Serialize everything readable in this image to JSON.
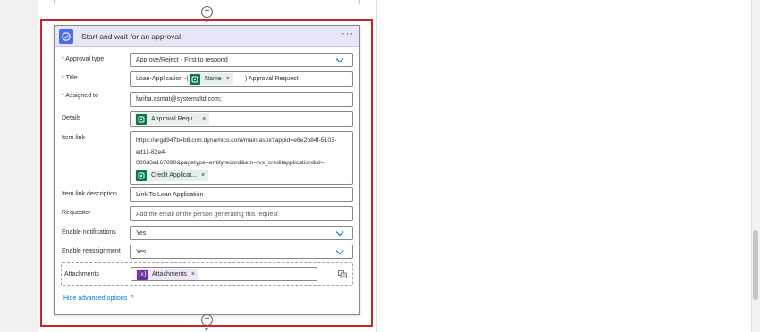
{
  "action": {
    "title": "Start and wait for an approval",
    "more_label": "···"
  },
  "fields": {
    "approval_type": {
      "label": "Approval type",
      "value": "Approve/Reject - First to respond"
    },
    "title": {
      "label": "Title",
      "prefix": "Loan-Application -(",
      "token": "Name",
      "suffix": ") Approval Request"
    },
    "assigned_to": {
      "label": "Assigned to",
      "value": "fariha.asmat@systemsltd.com;"
    },
    "details": {
      "label": "Details",
      "token": "Approval Requ..."
    },
    "item_link": {
      "label": "Item link",
      "line1": "https://orgd947b4b8.crm.dynamics.com/main.aspx?appid=e6e2b84f-5103-",
      "line2": "ed11-82e4-",
      "line3": "000d3a167890&pagetype=entityrecord&etn=tvs_creditapplication&id=",
      "token": "Credit Applicat..."
    },
    "item_link_description": {
      "label": "Item link description",
      "value": "Link To Loan Application"
    },
    "requestor": {
      "label": "Requestor",
      "placeholder": "Add the email of the person generating this request"
    },
    "enable_notifications": {
      "label": "Enable notifications",
      "value": "Yes"
    },
    "enable_reassignment": {
      "label": "Enable reassignment",
      "value": "Yes"
    },
    "attachments": {
      "label": "Attachments",
      "token": "Attachments",
      "token_icon_text": "{x}"
    }
  },
  "token_close": "×",
  "plus_label": "+",
  "hide_advanced_label": "Hide advanced options",
  "hide_advanced_caret": "^",
  "required_marker": "*",
  "colors": {
    "header_bg": "#e7e6f7",
    "action_icon": "#4f6bed",
    "dataverse_token": "#0b7a4a",
    "variable_token": "#6b2fa8",
    "highlight_frame": "#c9252c",
    "link_blue": "#0078d4"
  }
}
